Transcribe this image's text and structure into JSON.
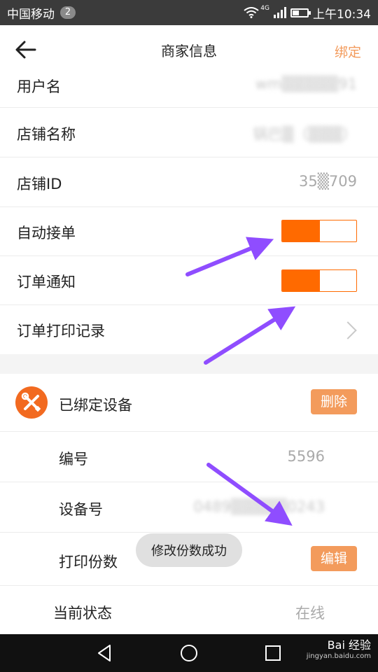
{
  "status_bar": {
    "carrier": "中国移动",
    "notification_count": "2",
    "network_type": "4G",
    "time": "上午10:34",
    "battery_level": 0.45
  },
  "header": {
    "title": "商家信息",
    "action_label": "绑定"
  },
  "rows": {
    "username": {
      "label": "用户名",
      "value": "wm▒▒▒▒▒91"
    },
    "shop_name": {
      "label": "店铺名称",
      "value": "锅巴▒（▒▒▒）"
    },
    "shop_id": {
      "label": "店铺ID",
      "value": "35▒709"
    },
    "auto_accept": {
      "label": "自动接单",
      "on": true
    },
    "order_notice": {
      "label": "订单通知",
      "on": true
    },
    "print_records": {
      "label": "订单打印记录"
    }
  },
  "device": {
    "title": "已绑定设备",
    "delete_label": "删除",
    "number": {
      "label": "编号",
      "value": "5596"
    },
    "device_no": {
      "label": "设备号",
      "value": "0489▒▒▒▒▒0243"
    },
    "copies": {
      "label": "打印份数",
      "value": "",
      "edit_label": "编辑"
    },
    "state": {
      "label": "当前状态",
      "value": "在线"
    }
  },
  "toast": {
    "message": "修改份数成功"
  },
  "watermark": {
    "brand": "Bai 经验",
    "url": "jingyan.baidu.com"
  },
  "colors": {
    "accent": "#ff6a00",
    "button": "#f39b5c",
    "annotation": "#8f4dff"
  }
}
